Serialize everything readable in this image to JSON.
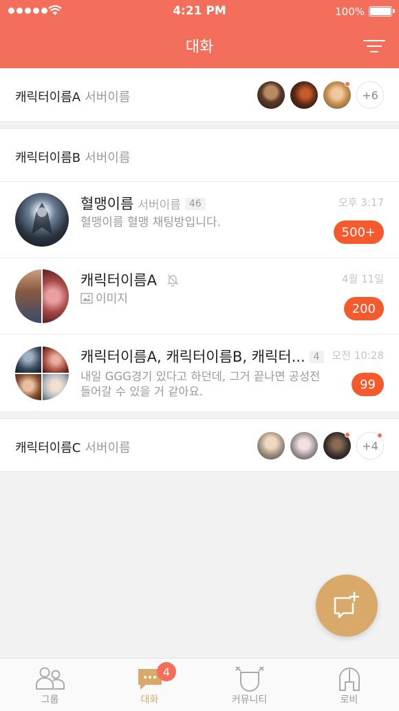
{
  "status": {
    "time": "4:21 PM",
    "battery": "100%"
  },
  "header": {
    "title": "대화"
  },
  "groups": [
    {
      "name": "캐릭터이름A",
      "server": "서버이름",
      "more": "+6"
    },
    {
      "name": "캐릭터이름B",
      "server": "서버이름"
    },
    {
      "name": "캐릭터이름C",
      "server": "서버이름",
      "more": "+4"
    }
  ],
  "chats": [
    {
      "name": "혈맹이름",
      "server": "서버이름",
      "count": "46",
      "time": "오후 3:17",
      "message": "혈맹이름 혈맹 채팅방입니다.",
      "badge": "500+"
    },
    {
      "name": "캐릭터이름A",
      "time": "4월 11일",
      "message": "이미지",
      "badge": "200"
    },
    {
      "name": "캐릭터이름A, 캐릭터이름B, 캐릭터...",
      "count": "4",
      "time": "오전 10:28",
      "message_line1": "내일 GGG경기 있다고 하던데, 그거 끝나면 공성전",
      "message_line2": "들어갈 수 있을 거 같아요.",
      "badge": "99"
    }
  ],
  "tabs": [
    {
      "label": "그룹"
    },
    {
      "label": "대화",
      "badge": "4"
    },
    {
      "label": "커뮤니티"
    },
    {
      "label": "로비"
    }
  ],
  "colors": {
    "accent": "#f36f5c",
    "gold": "#d9a96a",
    "badge": "#f55a2c"
  }
}
